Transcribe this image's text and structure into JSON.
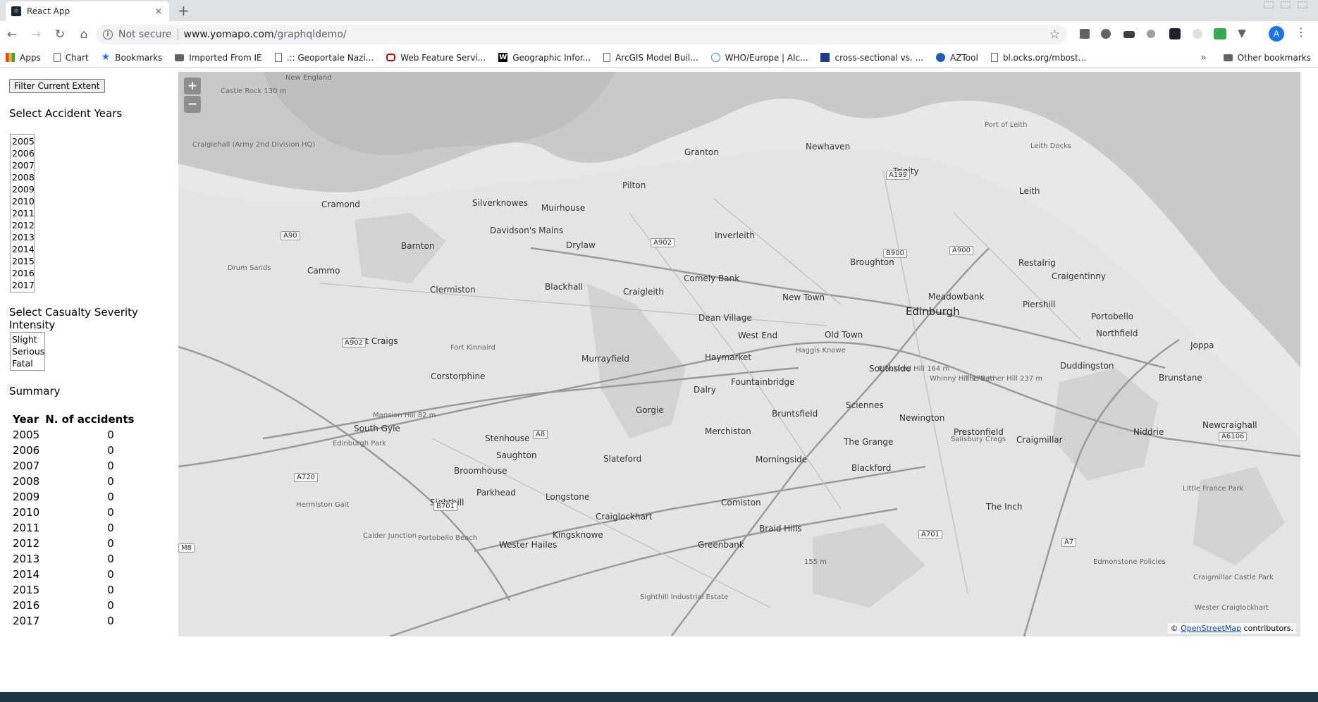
{
  "browser": {
    "tab_title": "React App",
    "tab_close": "×",
    "new_tab": "+",
    "security_label": "Not secure",
    "url_host": "www.yomapo.com",
    "url_path": "/graphqldemo/",
    "avatar_letter": "A",
    "bookmarks": [
      {
        "label": "Apps",
        "icon": "apps-icon"
      },
      {
        "label": "Chart",
        "icon": "page-icon"
      },
      {
        "label": "Bookmarks",
        "icon": "star-icon"
      },
      {
        "label": "Imported From IE",
        "icon": "folder-icon"
      },
      {
        "label": ".:: Geoportale Nazi...",
        "icon": "page-icon"
      },
      {
        "label": "Web Feature Servi...",
        "icon": "oracle-icon"
      },
      {
        "label": "Geographic Infor...",
        "icon": "wikipedia-icon"
      },
      {
        "label": "ArcGIS Model Buil...",
        "icon": "page-icon"
      },
      {
        "label": "WHO/Europe | Alc...",
        "icon": "who-icon"
      },
      {
        "label": "cross-sectional vs. ...",
        "icon": "site-icon"
      },
      {
        "label": "AZTool",
        "icon": "site-icon"
      },
      {
        "label": "bl.ocks.org/mbost...",
        "icon": "page-icon"
      }
    ],
    "overflow": "»",
    "other_bookmarks": "Other bookmarks"
  },
  "sidebar": {
    "filter_button": "Filter Current Extent",
    "years_heading": "Select Accident Years",
    "years": [
      "2005",
      "2006",
      "2007",
      "2008",
      "2009",
      "2010",
      "2011",
      "2012",
      "2013",
      "2014",
      "2015",
      "2016",
      "2017"
    ],
    "severity_heading": "Select Casualty Severity Intensity",
    "severities": [
      "Slight",
      "Serious",
      "Fatal"
    ],
    "summary_heading": "Summary",
    "summary": {
      "col_year": "Year",
      "col_count": "N. of accidents",
      "rows": [
        {
          "year": "2005",
          "count": "0"
        },
        {
          "year": "2006",
          "count": "0"
        },
        {
          "year": "2007",
          "count": "0"
        },
        {
          "year": "2008",
          "count": "0"
        },
        {
          "year": "2009",
          "count": "0"
        },
        {
          "year": "2010",
          "count": "0"
        },
        {
          "year": "2011",
          "count": "0"
        },
        {
          "year": "2012",
          "count": "0"
        },
        {
          "year": "2013",
          "count": "0"
        },
        {
          "year": "2014",
          "count": "0"
        },
        {
          "year": "2015",
          "count": "0"
        },
        {
          "year": "2016",
          "count": "0"
        },
        {
          "year": "2017",
          "count": "0"
        }
      ]
    }
  },
  "map": {
    "zoom_in": "+",
    "zoom_out": "−",
    "attribution_prefix": "©",
    "attribution_link": "OpenStreetMap",
    "attribution_suffix": "contributors.",
    "places": [
      {
        "name": "Granton",
        "cls": ""
      },
      {
        "name": "Newhaven",
        "cls": ""
      },
      {
        "name": "Trinity",
        "cls": ""
      },
      {
        "name": "Leith",
        "cls": ""
      },
      {
        "name": "Leith Docks",
        "cls": "small"
      },
      {
        "name": "Port of Leith",
        "cls": "small"
      },
      {
        "name": "Pilton",
        "cls": ""
      },
      {
        "name": "Cramond",
        "cls": ""
      },
      {
        "name": "Silverknowes",
        "cls": ""
      },
      {
        "name": "Muirhouse",
        "cls": ""
      },
      {
        "name": "Davidson's Mains",
        "cls": ""
      },
      {
        "name": "Drylaw",
        "cls": ""
      },
      {
        "name": "Barnton",
        "cls": ""
      },
      {
        "name": "Inverleith",
        "cls": ""
      },
      {
        "name": "Broughton",
        "cls": ""
      },
      {
        "name": "Restalrig",
        "cls": ""
      },
      {
        "name": "Craigentinny",
        "cls": ""
      },
      {
        "name": "Cammo",
        "cls": ""
      },
      {
        "name": "Clermiston",
        "cls": ""
      },
      {
        "name": "Blackhall",
        "cls": ""
      },
      {
        "name": "Craigleith",
        "cls": ""
      },
      {
        "name": "Comely Bank",
        "cls": ""
      },
      {
        "name": "New Town",
        "cls": ""
      },
      {
        "name": "Meadowbank",
        "cls": ""
      },
      {
        "name": "Piershill",
        "cls": ""
      },
      {
        "name": "Portobello",
        "cls": ""
      },
      {
        "name": "Edinburgh",
        "cls": "big"
      },
      {
        "name": "Dean Village",
        "cls": ""
      },
      {
        "name": "West End",
        "cls": ""
      },
      {
        "name": "Old Town",
        "cls": ""
      },
      {
        "name": "Northfield",
        "cls": ""
      },
      {
        "name": "Joppa",
        "cls": ""
      },
      {
        "name": "East Craigs",
        "cls": ""
      },
      {
        "name": "Murrayfield",
        "cls": ""
      },
      {
        "name": "Haymarket",
        "cls": ""
      },
      {
        "name": "Southside",
        "cls": ""
      },
      {
        "name": "Duddingston",
        "cls": ""
      },
      {
        "name": "Brunstane",
        "cls": ""
      },
      {
        "name": "Corstorphine",
        "cls": ""
      },
      {
        "name": "Dalry",
        "cls": ""
      },
      {
        "name": "Fountainbridge",
        "cls": ""
      },
      {
        "name": "Sciennes",
        "cls": ""
      },
      {
        "name": "Gorgie",
        "cls": ""
      },
      {
        "name": "Bruntsfield",
        "cls": ""
      },
      {
        "name": "Newington",
        "cls": ""
      },
      {
        "name": "South Gyle",
        "cls": ""
      },
      {
        "name": "Stenhouse",
        "cls": ""
      },
      {
        "name": "Merchiston",
        "cls": ""
      },
      {
        "name": "Prestonfield",
        "cls": ""
      },
      {
        "name": "Craigmillar",
        "cls": ""
      },
      {
        "name": "Niddrie",
        "cls": ""
      },
      {
        "name": "Newcraighall",
        "cls": ""
      },
      {
        "name": "Saughton",
        "cls": ""
      },
      {
        "name": "Slateford",
        "cls": ""
      },
      {
        "name": "The Grange",
        "cls": ""
      },
      {
        "name": "Broomhouse",
        "cls": ""
      },
      {
        "name": "Morningside",
        "cls": ""
      },
      {
        "name": "Blackford",
        "cls": ""
      },
      {
        "name": "Parkhead",
        "cls": ""
      },
      {
        "name": "Longstone",
        "cls": ""
      },
      {
        "name": "Sighthill",
        "cls": ""
      },
      {
        "name": "Comiston",
        "cls": ""
      },
      {
        "name": "The Inch",
        "cls": ""
      },
      {
        "name": "Craiglockhart",
        "cls": ""
      },
      {
        "name": "Braid Hills",
        "cls": ""
      },
      {
        "name": "Kingsknowe",
        "cls": ""
      },
      {
        "name": "Greenbank",
        "cls": ""
      },
      {
        "name": "Wester Hailes",
        "cls": ""
      },
      {
        "name": "Calder Junction",
        "cls": "small"
      },
      {
        "name": "Hermiston Gait",
        "cls": "small"
      },
      {
        "name": "Edinburgh Park",
        "cls": "small"
      },
      {
        "name": "Mansion Hill 82 m",
        "cls": "small"
      },
      {
        "name": "Craigiehall (Army 2nd Division HQ)",
        "cls": "small"
      },
      {
        "name": "Drum Sands",
        "cls": "small"
      },
      {
        "name": "New England",
        "cls": "small"
      },
      {
        "name": "Castle Rock 130 m",
        "cls": "small"
      },
      {
        "name": "Haggis Knowe",
        "cls": "small"
      },
      {
        "name": "Whinny Hill 178 m",
        "cls": "small"
      },
      {
        "name": "The Nether Hill 237 m",
        "cls": "small"
      },
      {
        "name": "Salisbury Crags",
        "cls": "small"
      },
      {
        "name": "Blackford Hill 164 m",
        "cls": "small"
      },
      {
        "name": "155 m",
        "cls": "small"
      },
      {
        "name": "Fort Kinnaird",
        "cls": "small"
      },
      {
        "name": "Little France Park",
        "cls": "small"
      },
      {
        "name": "Craigmillar Castle Park",
        "cls": "small"
      },
      {
        "name": "Edmonstone Policies",
        "cls": "small"
      },
      {
        "name": "Wester Craiglockhart",
        "cls": "small"
      },
      {
        "name": "Sighthill Industrial Estate",
        "cls": "small"
      },
      {
        "name": "Portobello Beach",
        "cls": "small"
      }
    ],
    "roads": [
      "A199",
      "A902",
      "A90",
      "B900",
      "A900",
      "A8",
      "A720",
      "B701",
      "A6106",
      "A701",
      "A7",
      "M8",
      "A902"
    ]
  }
}
